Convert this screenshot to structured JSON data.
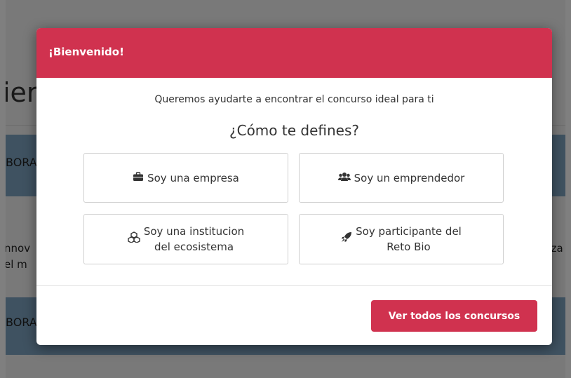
{
  "background": {
    "title_fragment": "iere",
    "band1_text": "BORA",
    "band2_text": "BORA",
    "left_text_line1": "nnov",
    "left_text_line2": "el m",
    "right_text": "niza"
  },
  "modal": {
    "title": "¡Bienvenido!",
    "subtitle": "Queremos ayudarte a encontrar el concurso ideal para ti",
    "question": "¿Cómo te defines?",
    "options": [
      {
        "icon": "briefcase-icon",
        "glyph": "💼",
        "label": "Soy una empresa"
      },
      {
        "icon": "users-icon",
        "glyph": "👥",
        "label": "Soy un emprendedor"
      },
      {
        "icon": "cubes-icon",
        "glyph": "❖",
        "label": "Soy una institucion\ndel ecosistema"
      },
      {
        "icon": "rocket-icon",
        "glyph": "🚀",
        "label": "Soy participante del\nReto Bio"
      }
    ],
    "cta_label": "Ver todos los concursos"
  },
  "colors": {
    "accent": "#d0324f",
    "band": "#7fa5c2"
  }
}
